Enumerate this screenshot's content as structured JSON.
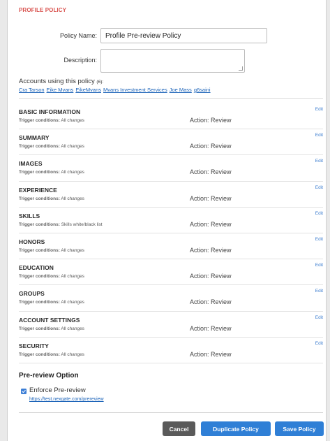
{
  "header": {
    "title": "PROFILE POLICY"
  },
  "form": {
    "policy_name_label": "Policy Name:",
    "policy_name_value": "Profile Pre-review Policy",
    "description_label": "Description:",
    "description_value": ""
  },
  "accounts": {
    "title": "Accounts using this policy",
    "count": "(6):",
    "links": [
      "Cra Tarson",
      "Eike Mvans",
      "EikeMvans",
      "Mvans Investment Services",
      "Joe Mass",
      "g6saini"
    ]
  },
  "rules": [
    {
      "name": "BASIC INFORMATION",
      "trigger_label": "Trigger conditions:",
      "trigger_value": "All changes",
      "action": "Action: Review",
      "edit": "Edit"
    },
    {
      "name": "SUMMARY",
      "trigger_label": "Trigger conditions:",
      "trigger_value": "All changes",
      "action": "Action: Review",
      "edit": "Edit"
    },
    {
      "name": "IMAGES",
      "trigger_label": "Trigger conditions:",
      "trigger_value": "All changes",
      "action": "Action: Review",
      "edit": "Edit"
    },
    {
      "name": "EXPERIENCE",
      "trigger_label": "Trigger conditions:",
      "trigger_value": "All changes",
      "action": "Action: Review",
      "edit": "Edit"
    },
    {
      "name": "SKILLS",
      "trigger_label": "Trigger conditions:",
      "trigger_value": "Skills white/black list",
      "action": "Action: Review",
      "edit": "Edit"
    },
    {
      "name": "HONORS",
      "trigger_label": "Trigger conditions:",
      "trigger_value": "All changes",
      "action": "Action: Review",
      "edit": "Edit"
    },
    {
      "name": "EDUCATION",
      "trigger_label": "Trigger conditions:",
      "trigger_value": "All changes",
      "action": "Action: Review",
      "edit": "Edit"
    },
    {
      "name": "GROUPS",
      "trigger_label": "Trigger conditions:",
      "trigger_value": "All changes",
      "action": "Action: Review",
      "edit": "Edit"
    },
    {
      "name": "ACCOUNT SETTINGS",
      "trigger_label": "Trigger conditions:",
      "trigger_value": "All changes",
      "action": "Action: Review",
      "edit": "Edit"
    },
    {
      "name": "SECURITY",
      "trigger_label": "Trigger conditions:",
      "trigger_value": "All changes",
      "action": "Action: Review",
      "edit": "Edit"
    }
  ],
  "pre_review": {
    "title": "Pre-review Option",
    "checkbox_label": "Enforce Pre-review",
    "checked": true,
    "link": "https://test.nexgate.com/prereview"
  },
  "buttons": {
    "cancel": "Cancel",
    "duplicate": "Duplicate Policy",
    "save": "Save Policy"
  },
  "colors": {
    "accent_red": "#d9534f",
    "link_blue": "#1a62b8",
    "button_blue": "#2f7fd6",
    "button_gray": "#5a5a5a"
  },
  "icons": {
    "checkbox": "check-icon"
  }
}
